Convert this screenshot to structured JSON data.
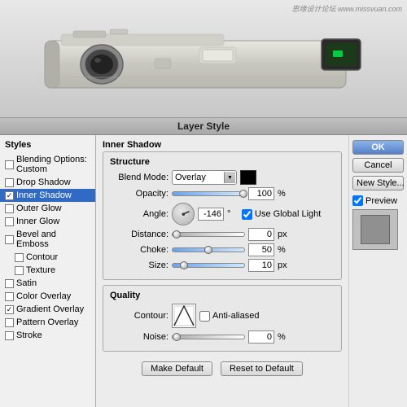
{
  "watermark": "思缘设计论坛  www.missvuan.com",
  "dialog": {
    "title": "Layer Style",
    "styles_panel": {
      "title": "Styles",
      "items": [
        {
          "id": "blending-options",
          "label": "Blending Options: Custom",
          "checked": false,
          "selected": false,
          "level": 0
        },
        {
          "id": "drop-shadow",
          "label": "Drop Shadow",
          "checked": false,
          "selected": false,
          "level": 0
        },
        {
          "id": "inner-shadow",
          "label": "Inner Shadow",
          "checked": true,
          "selected": true,
          "level": 0
        },
        {
          "id": "outer-glow",
          "label": "Outer Glow",
          "checked": false,
          "selected": false,
          "level": 0
        },
        {
          "id": "inner-glow",
          "label": "Inner Glow",
          "checked": false,
          "selected": false,
          "level": 0
        },
        {
          "id": "bevel-emboss",
          "label": "Bevel and Emboss",
          "checked": false,
          "selected": false,
          "level": 0
        },
        {
          "id": "contour",
          "label": "Contour",
          "checked": false,
          "selected": false,
          "level": 1
        },
        {
          "id": "texture",
          "label": "Texture",
          "checked": false,
          "selected": false,
          "level": 1
        },
        {
          "id": "satin",
          "label": "Satin",
          "checked": false,
          "selected": false,
          "level": 0
        },
        {
          "id": "color-overlay",
          "label": "Color Overlay",
          "checked": false,
          "selected": false,
          "level": 0
        },
        {
          "id": "gradient-overlay",
          "label": "Gradient Overlay",
          "checked": true,
          "selected": false,
          "level": 0
        },
        {
          "id": "pattern-overlay",
          "label": "Pattern Overlay",
          "checked": false,
          "selected": false,
          "level": 0
        },
        {
          "id": "stroke",
          "label": "Stroke",
          "checked": false,
          "selected": false,
          "level": 0
        }
      ]
    },
    "inner_shadow": {
      "section_title": "Inner Shadow",
      "structure_title": "Structure",
      "blend_mode_label": "Blend Mode:",
      "blend_mode_value": "Overlay",
      "opacity_label": "Opacity:",
      "opacity_value": "100",
      "opacity_unit": "%",
      "angle_label": "Angle:",
      "angle_value": "-146",
      "angle_unit": "°",
      "use_global_light": "Use Global Light",
      "distance_label": "Distance:",
      "distance_value": "0",
      "distance_unit": "px",
      "choke_label": "Choke:",
      "choke_value": "50",
      "choke_unit": "%",
      "size_label": "Size:",
      "size_value": "10",
      "size_unit": "px",
      "quality_title": "Quality",
      "contour_label": "Contour:",
      "anti_aliased": "Anti-aliased",
      "noise_label": "Noise:",
      "noise_value": "0",
      "noise_unit": "%"
    },
    "buttons": {
      "make_default": "Make Default",
      "reset_to_default": "Reset to Default",
      "ok": "OK",
      "cancel": "Cancel",
      "new_style": "New Style...",
      "preview": "Preview"
    }
  }
}
